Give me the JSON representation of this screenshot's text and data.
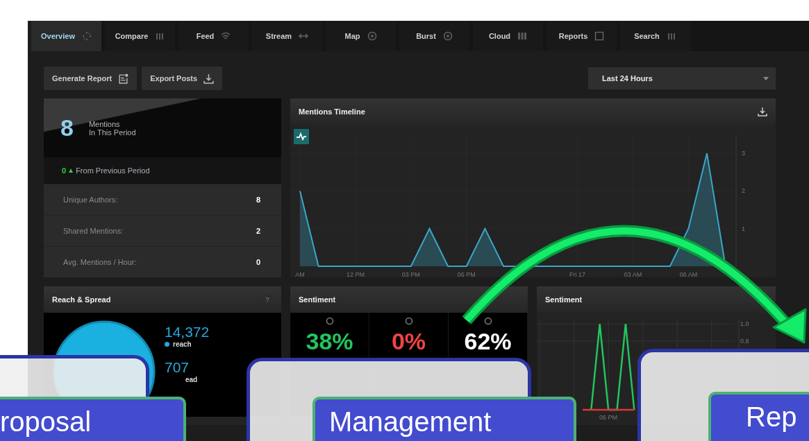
{
  "tabs": [
    {
      "label": "Overview",
      "selected": true
    },
    {
      "label": "Compare",
      "selected": false
    },
    {
      "label": "Feed",
      "selected": false
    },
    {
      "label": "Stream",
      "selected": false
    },
    {
      "label": "Map",
      "selected": false
    },
    {
      "label": "Burst",
      "selected": false
    },
    {
      "label": "Cloud",
      "selected": false
    },
    {
      "label": "Reports",
      "selected": false
    },
    {
      "label": "Search",
      "selected": false
    }
  ],
  "toolbar": {
    "buttons": [
      "Generate Report",
      "Export Posts"
    ],
    "range": "Last 24 Hours"
  },
  "summary": {
    "count": "8",
    "label_line1": "Mentions",
    "label_line2": "In This Period",
    "change": "0",
    "change_label": "From Previous Period",
    "stats": [
      {
        "label": "Unique Authors:",
        "value": "8"
      },
      {
        "label": "Shared Mentions:",
        "value": "2"
      },
      {
        "label": "Avg. Mentions / Hour:",
        "value": "0"
      }
    ]
  },
  "timeline": {
    "title": "Mentions Timeline",
    "chart_data": {
      "type": "area",
      "categories": [
        "AM",
        null,
        null,
        "12 PM",
        null,
        null,
        "03 PM",
        null,
        null,
        "06 PM",
        null,
        null,
        null,
        null,
        null,
        "Fri 17",
        null,
        null,
        "03 AM",
        null,
        null,
        "06 AM",
        null,
        null
      ],
      "series": [
        {
          "color": "#3aa6c8",
          "values": [
            2,
            0,
            0,
            0,
            0,
            0,
            0,
            1,
            0,
            0,
            1,
            0,
            0,
            0,
            0,
            0,
            0,
            0,
            0,
            0,
            0,
            1,
            3,
            0
          ]
        }
      ],
      "ylim": [
        0,
        3.5
      ],
      "yticks": [
        1,
        2,
        3
      ],
      "grid": true
    }
  },
  "reach": {
    "title": "Reach & Spread",
    "help": "?",
    "reach_value": "14,372",
    "reach_label": "reach",
    "spread_value": "707",
    "spread_label": "ead"
  },
  "sentiment": {
    "title": "Sentiment",
    "items": [
      {
        "value": "38%",
        "color": "#22c55e"
      },
      {
        "value": "0%",
        "color": "#ef4444"
      },
      {
        "value": "62%",
        "color": "#ffffff"
      }
    ]
  },
  "sentiment_trend": {
    "title": "Sentiment",
    "x_label": "06 PM",
    "chart_data": {
      "type": "line",
      "grid": true,
      "categories": [
        null,
        null,
        null,
        null,
        null,
        null,
        null,
        null,
        null,
        null,
        null,
        null,
        null,
        null,
        null,
        null,
        null,
        null,
        null,
        null,
        null,
        null,
        null
      ],
      "series": [
        {
          "color": "#22c55e",
          "values": [
            null,
            null,
            null,
            null,
            null,
            null,
            0,
            1,
            0,
            0,
            1,
            0,
            null,
            null,
            null,
            null,
            null,
            null,
            null,
            null,
            null,
            null,
            null
          ]
        },
        {
          "color": "#e03535",
          "values": [
            null,
            null,
            null,
            null,
            null,
            0,
            0,
            0,
            0,
            0,
            0,
            0,
            null,
            null,
            null,
            null,
            null,
            null,
            null,
            null,
            null,
            null,
            null
          ]
        }
      ],
      "ylim": [
        0,
        1.05
      ],
      "yticks": [
        {
          "value": 0.8,
          "label": "0.8"
        },
        {
          "value": 1.0,
          "label": "1.0"
        }
      ]
    }
  },
  "callouts": [
    {
      "label": "roposal"
    },
    {
      "label": "Management"
    },
    {
      "label": "Rep"
    }
  ]
}
